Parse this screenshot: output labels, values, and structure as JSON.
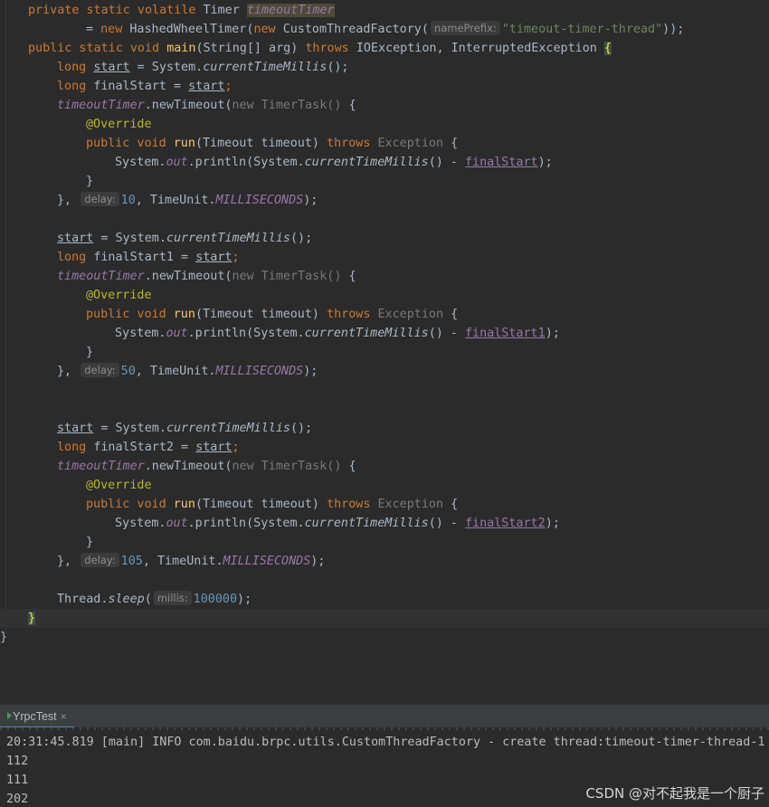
{
  "code": {
    "l1": {
      "kw": "private static volatile ",
      "type": "Timer ",
      "field": "timeoutTimer"
    },
    "l2": {
      "eq": "= ",
      "kw_new": "new ",
      "cls": "HashedWheelTimer(",
      "kw_new2": "new ",
      "cls2": "CustomThreadFactory(",
      "hint": "namePrefix:",
      "str": "\"timeout-timer-thread\"",
      "end": "));"
    },
    "l3": {
      "kw": "public static void ",
      "name": "main",
      "params": "(String[] arg) ",
      "throws": "throws ",
      "exc": "IOException, InterruptedException ",
      "brace": "{"
    },
    "l4": {
      "kw": "long ",
      "var": "start",
      "rest": " = System.",
      "call": "currentTimeMillis",
      "end": "();"
    },
    "l5": {
      "kw": "long ",
      "rest": "finalStart = ",
      "var": "start",
      "semi": ";"
    },
    "l6": {
      "field": "timeoutTimer",
      "rest": ".newTimeout(",
      "gray": "new TimerTask() ",
      "brace": "{"
    },
    "l7": {
      "annot": "@Override"
    },
    "l8": {
      "kw": "public void ",
      "name": "run",
      "params": "(Timeout timeout) ",
      "throws": "throws ",
      "exc": "Exception ",
      "brace": "{"
    },
    "l9": {
      "pre": "System.",
      "out": "out",
      "mid": ".println(System.",
      "call": "currentTimeMillis",
      "minus": "() - ",
      "var": "finalStart",
      "end": ");"
    },
    "l10": {
      "brace": "}"
    },
    "l11": {
      "close": "}, ",
      "hint": "delay:",
      "num": "10",
      "rest": ", TimeUnit.",
      "const": "MILLISECONDS",
      "end": ");"
    },
    "l13": {
      "var": "start",
      "rest": " = System.",
      "call": "currentTimeMillis",
      "end": "();"
    },
    "l14": {
      "kw": "long ",
      "rest": "finalStart1 = ",
      "var": "start",
      "semi": ";"
    },
    "l15": {
      "field": "timeoutTimer",
      "rest": ".newTimeout(",
      "gray": "new TimerTask() ",
      "brace": "{"
    },
    "l16": {
      "annot": "@Override"
    },
    "l17": {
      "kw": "public void ",
      "name": "run",
      "params": "(Timeout timeout) ",
      "throws": "throws ",
      "exc": "Exception ",
      "brace": "{"
    },
    "l18": {
      "pre": "System.",
      "out": "out",
      "mid": ".println(System.",
      "call": "currentTimeMillis",
      "minus": "() - ",
      "var": "finalStart1",
      "end": ");"
    },
    "l19": {
      "brace": "}"
    },
    "l20": {
      "close": "}, ",
      "hint": "delay:",
      "num": "50",
      "rest": ", TimeUnit.",
      "const": "MILLISECONDS",
      "end": ");"
    },
    "l23": {
      "var": "start",
      "rest": " = System.",
      "call": "currentTimeMillis",
      "end": "();"
    },
    "l24": {
      "kw": "long ",
      "rest": "finalStart2 = ",
      "var": "start",
      "semi": ";"
    },
    "l25": {
      "field": "timeoutTimer",
      "rest": ".newTimeout(",
      "gray": "new TimerTask() ",
      "brace": "{"
    },
    "l26": {
      "annot": "@Override"
    },
    "l27": {
      "kw": "public void ",
      "name": "run",
      "params": "(Timeout timeout) ",
      "throws": "throws ",
      "exc": "Exception ",
      "brace": "{"
    },
    "l28": {
      "pre": "System.",
      "out": "out",
      "mid": ".println(System.",
      "call": "currentTimeMillis",
      "minus": "() - ",
      "var": "finalStart2",
      "end": ");"
    },
    "l29": {
      "brace": "}"
    },
    "l30": {
      "close": "}, ",
      "hint": "delay:",
      "num": "105",
      "rest": ", TimeUnit.",
      "const": "MILLISECONDS",
      "end": ");"
    },
    "l32": {
      "pre": "Thread.",
      "call": "sleep",
      "open": "(",
      "hint": "millis:",
      "num": "100000",
      "end": ");"
    },
    "l33": {
      "brace": "}"
    },
    "l34": {
      "brace": "}"
    }
  },
  "run_tab": {
    "label": "YrpcTest",
    "close": "×"
  },
  "console": {
    "lines": [
      "20:31:45.819 [main] INFO com.baidu.brpc.utils.CustomThreadFactory - create thread:timeout-timer-thread-1",
      "112",
      "111",
      "202"
    ]
  },
  "watermark": "CSDN @对不起我是一个厨子",
  "colors": {
    "background": "#2b2b2b",
    "keyword": "#cc7832",
    "string": "#6a8759",
    "number": "#6897bb",
    "field": "#9876aa",
    "annotation": "#bbb529",
    "method_decl": "#ffc66d"
  }
}
